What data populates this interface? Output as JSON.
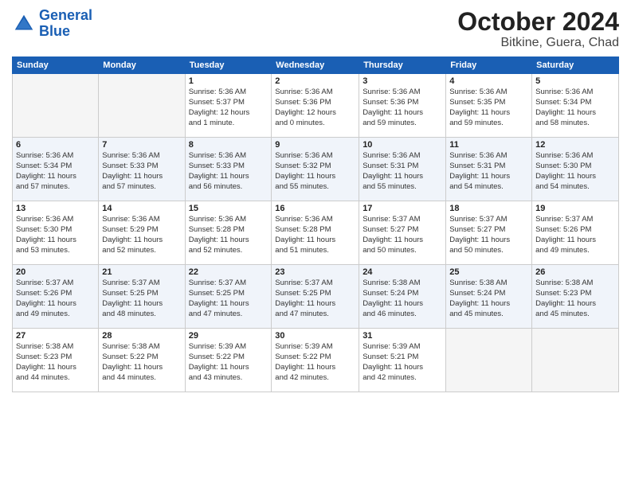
{
  "header": {
    "logo_general": "General",
    "logo_blue": "Blue",
    "month": "October 2024",
    "location": "Bitkine, Guera, Chad"
  },
  "columns": [
    "Sunday",
    "Monday",
    "Tuesday",
    "Wednesday",
    "Thursday",
    "Friday",
    "Saturday"
  ],
  "weeks": [
    [
      {
        "day": "",
        "info": ""
      },
      {
        "day": "",
        "info": ""
      },
      {
        "day": "1",
        "info": "Sunrise: 5:36 AM\nSunset: 5:37 PM\nDaylight: 12 hours\nand 1 minute."
      },
      {
        "day": "2",
        "info": "Sunrise: 5:36 AM\nSunset: 5:36 PM\nDaylight: 12 hours\nand 0 minutes."
      },
      {
        "day": "3",
        "info": "Sunrise: 5:36 AM\nSunset: 5:36 PM\nDaylight: 11 hours\nand 59 minutes."
      },
      {
        "day": "4",
        "info": "Sunrise: 5:36 AM\nSunset: 5:35 PM\nDaylight: 11 hours\nand 59 minutes."
      },
      {
        "day": "5",
        "info": "Sunrise: 5:36 AM\nSunset: 5:34 PM\nDaylight: 11 hours\nand 58 minutes."
      }
    ],
    [
      {
        "day": "6",
        "info": "Sunrise: 5:36 AM\nSunset: 5:34 PM\nDaylight: 11 hours\nand 57 minutes."
      },
      {
        "day": "7",
        "info": "Sunrise: 5:36 AM\nSunset: 5:33 PM\nDaylight: 11 hours\nand 57 minutes."
      },
      {
        "day": "8",
        "info": "Sunrise: 5:36 AM\nSunset: 5:33 PM\nDaylight: 11 hours\nand 56 minutes."
      },
      {
        "day": "9",
        "info": "Sunrise: 5:36 AM\nSunset: 5:32 PM\nDaylight: 11 hours\nand 55 minutes."
      },
      {
        "day": "10",
        "info": "Sunrise: 5:36 AM\nSunset: 5:31 PM\nDaylight: 11 hours\nand 55 minutes."
      },
      {
        "day": "11",
        "info": "Sunrise: 5:36 AM\nSunset: 5:31 PM\nDaylight: 11 hours\nand 54 minutes."
      },
      {
        "day": "12",
        "info": "Sunrise: 5:36 AM\nSunset: 5:30 PM\nDaylight: 11 hours\nand 54 minutes."
      }
    ],
    [
      {
        "day": "13",
        "info": "Sunrise: 5:36 AM\nSunset: 5:30 PM\nDaylight: 11 hours\nand 53 minutes."
      },
      {
        "day": "14",
        "info": "Sunrise: 5:36 AM\nSunset: 5:29 PM\nDaylight: 11 hours\nand 52 minutes."
      },
      {
        "day": "15",
        "info": "Sunrise: 5:36 AM\nSunset: 5:28 PM\nDaylight: 11 hours\nand 52 minutes."
      },
      {
        "day": "16",
        "info": "Sunrise: 5:36 AM\nSunset: 5:28 PM\nDaylight: 11 hours\nand 51 minutes."
      },
      {
        "day": "17",
        "info": "Sunrise: 5:37 AM\nSunset: 5:27 PM\nDaylight: 11 hours\nand 50 minutes."
      },
      {
        "day": "18",
        "info": "Sunrise: 5:37 AM\nSunset: 5:27 PM\nDaylight: 11 hours\nand 50 minutes."
      },
      {
        "day": "19",
        "info": "Sunrise: 5:37 AM\nSunset: 5:26 PM\nDaylight: 11 hours\nand 49 minutes."
      }
    ],
    [
      {
        "day": "20",
        "info": "Sunrise: 5:37 AM\nSunset: 5:26 PM\nDaylight: 11 hours\nand 49 minutes."
      },
      {
        "day": "21",
        "info": "Sunrise: 5:37 AM\nSunset: 5:25 PM\nDaylight: 11 hours\nand 48 minutes."
      },
      {
        "day": "22",
        "info": "Sunrise: 5:37 AM\nSunset: 5:25 PM\nDaylight: 11 hours\nand 47 minutes."
      },
      {
        "day": "23",
        "info": "Sunrise: 5:37 AM\nSunset: 5:25 PM\nDaylight: 11 hours\nand 47 minutes."
      },
      {
        "day": "24",
        "info": "Sunrise: 5:38 AM\nSunset: 5:24 PM\nDaylight: 11 hours\nand 46 minutes."
      },
      {
        "day": "25",
        "info": "Sunrise: 5:38 AM\nSunset: 5:24 PM\nDaylight: 11 hours\nand 45 minutes."
      },
      {
        "day": "26",
        "info": "Sunrise: 5:38 AM\nSunset: 5:23 PM\nDaylight: 11 hours\nand 45 minutes."
      }
    ],
    [
      {
        "day": "27",
        "info": "Sunrise: 5:38 AM\nSunset: 5:23 PM\nDaylight: 11 hours\nand 44 minutes."
      },
      {
        "day": "28",
        "info": "Sunrise: 5:38 AM\nSunset: 5:22 PM\nDaylight: 11 hours\nand 44 minutes."
      },
      {
        "day": "29",
        "info": "Sunrise: 5:39 AM\nSunset: 5:22 PM\nDaylight: 11 hours\nand 43 minutes."
      },
      {
        "day": "30",
        "info": "Sunrise: 5:39 AM\nSunset: 5:22 PM\nDaylight: 11 hours\nand 42 minutes."
      },
      {
        "day": "31",
        "info": "Sunrise: 5:39 AM\nSunset: 5:21 PM\nDaylight: 11 hours\nand 42 minutes."
      },
      {
        "day": "",
        "info": ""
      },
      {
        "day": "",
        "info": ""
      }
    ]
  ]
}
